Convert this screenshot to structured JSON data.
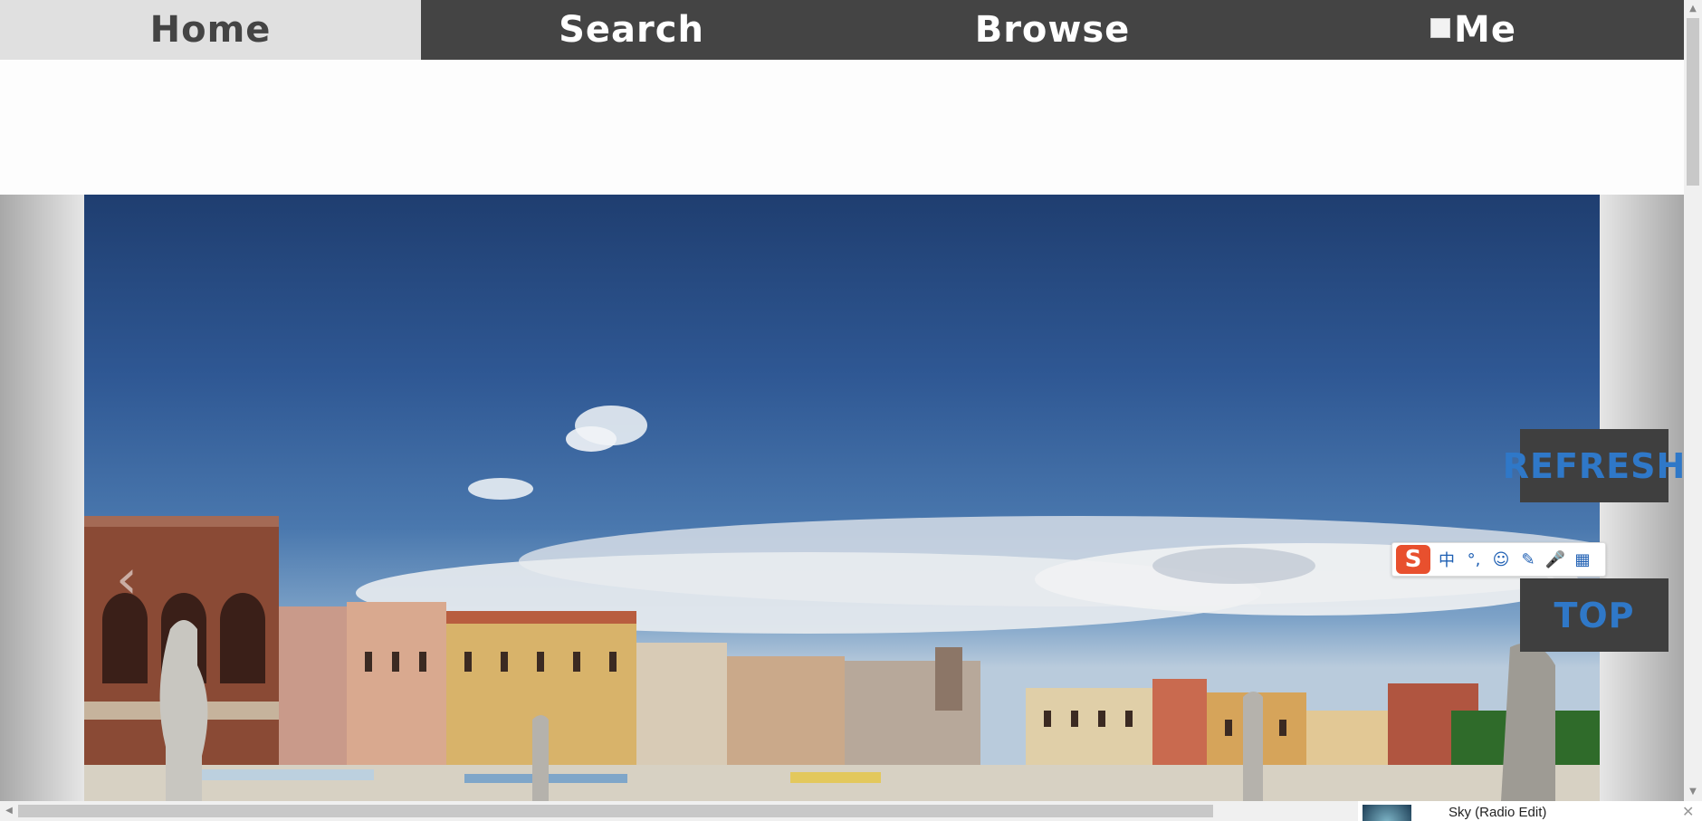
{
  "nav": {
    "tabs": [
      {
        "label": "Home",
        "active": true
      },
      {
        "label": "Search",
        "active": false
      },
      {
        "label": "Browse",
        "active": false
      },
      {
        "label": "Me",
        "active": false
      }
    ]
  },
  "carousel": {
    "prev_glyph": "‹",
    "next_glyph": "›"
  },
  "side_buttons": {
    "refresh_label": "REFRESH",
    "top_label": "TOP",
    "accent_color": "#2f78c8"
  },
  "ime_toolbar": {
    "logo": "S",
    "items": [
      "中",
      "°,",
      "☺",
      "✎",
      "🎤",
      "▦"
    ]
  },
  "player": {
    "track_title": "Sky (Radio Edit)",
    "close_glyph": "✕"
  }
}
